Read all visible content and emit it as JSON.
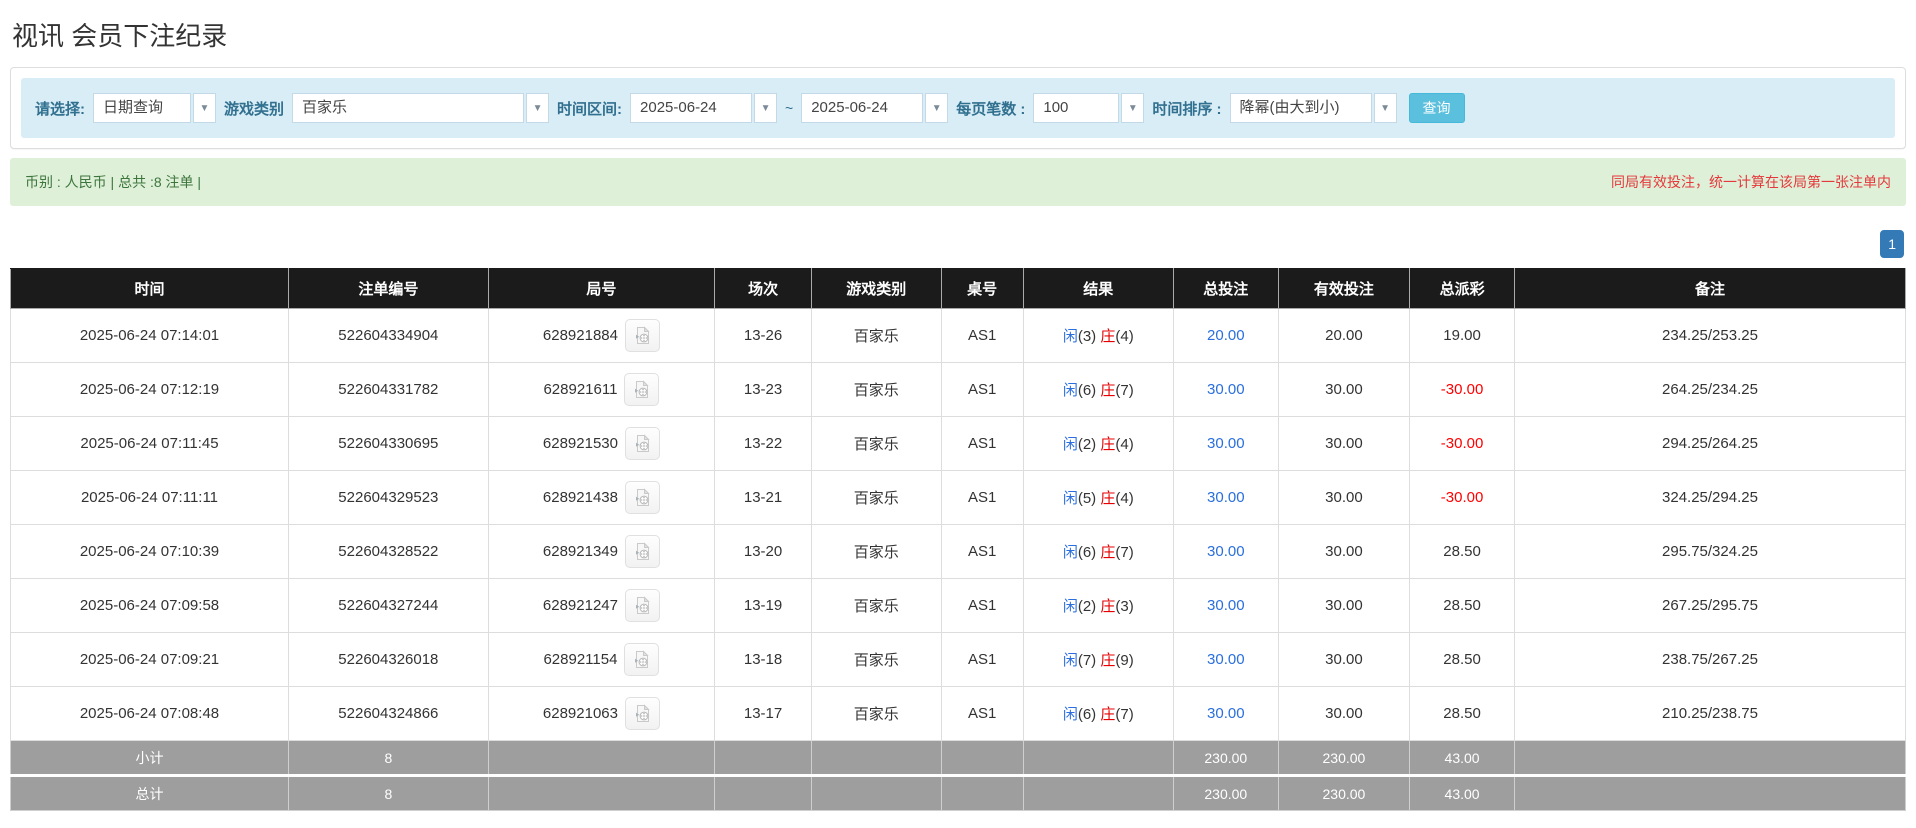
{
  "page_title": "视讯 会员下注纪录",
  "filters": {
    "select_label": "请选择:",
    "select_value": "日期查询",
    "game_type_label": "游戏类别",
    "game_type_value": "百家乐",
    "time_range_label": "时间区间:",
    "date_from": "2025-06-24",
    "date_to": "2025-06-24",
    "tilde": "~",
    "page_size_label": "每页笔数 :",
    "page_size_value": "100",
    "sort_label": "时间排序 :",
    "sort_value": "降幂(由大到小)",
    "search_button": "查询"
  },
  "summary": {
    "left_text": "币别 : 人民币 | 总共 :8 注单 |",
    "right_note": "同局有效投注，统一计算在该局第一张注单内"
  },
  "pagination": {
    "current_page": "1"
  },
  "colors": {
    "header_bg": "#1b1b1b",
    "footer_gray": "#9e9e9e",
    "filter_bg": "#d9edf7",
    "filter_label": "#31708f",
    "summary_bg": "#dff0d8",
    "summary_text": "#3c763d",
    "note_red": "#e4393c",
    "link_blue": "#2a6fdd",
    "banker_red": "#e60000",
    "negative_red": "#ff0000",
    "pagination_blue": "#337ab7",
    "search_button_bg": "#5bc0de"
  },
  "table": {
    "headers": [
      "时间",
      "注单编号",
      "局号",
      "场次",
      "游戏类别",
      "桌号",
      "结果",
      "总投注",
      "有效投注",
      "总派彩",
      "备注"
    ],
    "col_widths_pct": [
      14.67,
      10.54,
      11.95,
      5.11,
      6.84,
      4.33,
      7.93,
      5.53,
      6.94,
      5.53,
      20.63
    ],
    "rows": [
      {
        "time": "2025-06-24 07:14:01",
        "bet_id": "522604334904",
        "round_id": "628921884",
        "session": "13-26",
        "game": "百家乐",
        "table_no": "AS1",
        "result_player": "闲(3)",
        "result_banker": "庄(4)",
        "total_bet": "20.00",
        "valid_bet": "20.00",
        "payout": "19.00",
        "remark": "234.25/253.25"
      },
      {
        "time": "2025-06-24 07:12:19",
        "bet_id": "522604331782",
        "round_id": "628921611",
        "session": "13-23",
        "game": "百家乐",
        "table_no": "AS1",
        "result_player": "闲(6)",
        "result_banker": "庄(7)",
        "total_bet": "30.00",
        "valid_bet": "30.00",
        "payout": "-30.00",
        "remark": "264.25/234.25"
      },
      {
        "time": "2025-06-24 07:11:45",
        "bet_id": "522604330695",
        "round_id": "628921530",
        "session": "13-22",
        "game": "百家乐",
        "table_no": "AS1",
        "result_player": "闲(2)",
        "result_banker": "庄(4)",
        "total_bet": "30.00",
        "valid_bet": "30.00",
        "payout": "-30.00",
        "remark": "294.25/264.25"
      },
      {
        "time": "2025-06-24 07:11:11",
        "bet_id": "522604329523",
        "round_id": "628921438",
        "session": "13-21",
        "game": "百家乐",
        "table_no": "AS1",
        "result_player": "闲(5)",
        "result_banker": "庄(4)",
        "total_bet": "30.00",
        "valid_bet": "30.00",
        "payout": "-30.00",
        "remark": "324.25/294.25"
      },
      {
        "time": "2025-06-24 07:10:39",
        "bet_id": "522604328522",
        "round_id": "628921349",
        "session": "13-20",
        "game": "百家乐",
        "table_no": "AS1",
        "result_player": "闲(6)",
        "result_banker": "庄(7)",
        "total_bet": "30.00",
        "valid_bet": "30.00",
        "payout": "28.50",
        "remark": "295.75/324.25"
      },
      {
        "time": "2025-06-24 07:09:58",
        "bet_id": "522604327244",
        "round_id": "628921247",
        "session": "13-19",
        "game": "百家乐",
        "table_no": "AS1",
        "result_player": "闲(2)",
        "result_banker": "庄(3)",
        "total_bet": "30.00",
        "valid_bet": "30.00",
        "payout": "28.50",
        "remark": "267.25/295.75"
      },
      {
        "time": "2025-06-24 07:09:21",
        "bet_id": "522604326018",
        "round_id": "628921154",
        "session": "13-18",
        "game": "百家乐",
        "table_no": "AS1",
        "result_player": "闲(7)",
        "result_banker": "庄(9)",
        "total_bet": "30.00",
        "valid_bet": "30.00",
        "payout": "28.50",
        "remark": "238.75/267.25"
      },
      {
        "time": "2025-06-24 07:08:48",
        "bet_id": "522604324866",
        "round_id": "628921063",
        "session": "13-17",
        "game": "百家乐",
        "table_no": "AS1",
        "result_player": "闲(6)",
        "result_banker": "庄(7)",
        "total_bet": "30.00",
        "valid_bet": "30.00",
        "payout": "28.50",
        "remark": "210.25/238.75"
      }
    ],
    "footer": [
      {
        "label": "小计",
        "count": "8",
        "total_bet": "230.00",
        "valid_bet": "230.00",
        "payout": "43.00"
      },
      {
        "label": "总计",
        "count": "8",
        "total_bet": "230.00",
        "valid_bet": "230.00",
        "payout": "43.00"
      }
    ]
  }
}
